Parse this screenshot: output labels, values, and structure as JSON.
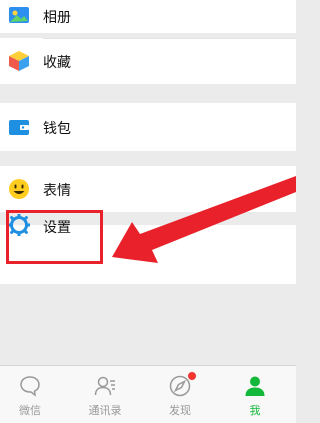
{
  "menu": {
    "album": "相册",
    "favorites": "收藏",
    "wallet": "钱包",
    "stickers": "表情",
    "settings": "设置"
  },
  "tabbar": {
    "wechat": "微信",
    "contacts": "通讯录",
    "discover": "发现",
    "me": "我"
  },
  "colors": {
    "accent": "#13b83b",
    "highlight": "#e8212b",
    "badge": "#f43530"
  },
  "icons": {
    "album": "album-icon",
    "favorites": "favorites-cube-icon",
    "wallet": "wallet-icon",
    "stickers": "smiley-icon",
    "settings": "gear-icon"
  }
}
